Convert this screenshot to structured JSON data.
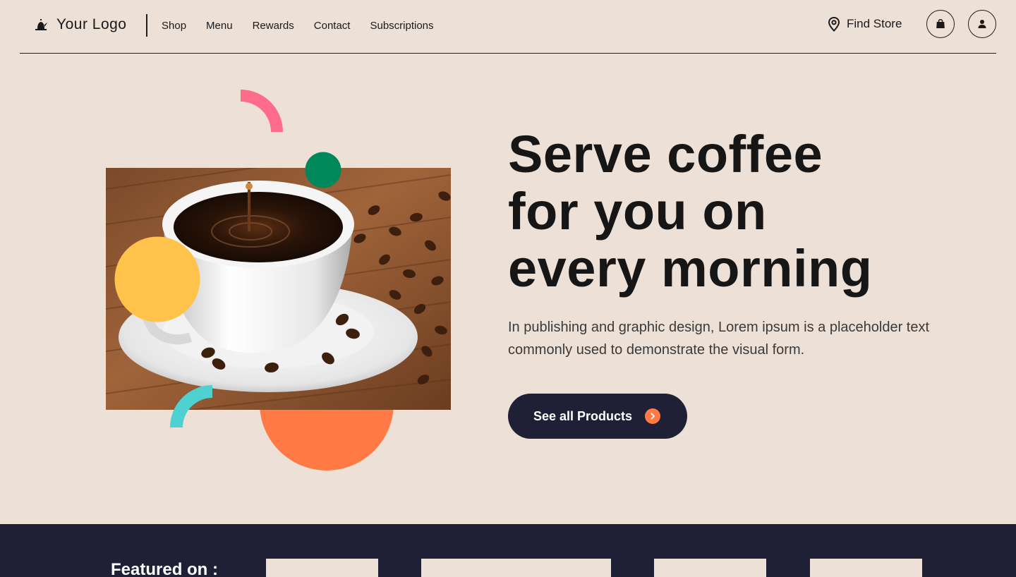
{
  "header": {
    "logo_text": "Your Logo",
    "nav": [
      "Shop",
      "Menu",
      "Rewards",
      "Contact",
      "Subscriptions"
    ],
    "find_store": "Find Store",
    "icons": {
      "logo": "coffee-kettle-icon",
      "find_store": "map-pin-icon",
      "cart": "shopping-bag-icon",
      "account": "user-icon"
    }
  },
  "hero": {
    "title_lines": [
      "Serve coffee",
      "for you on",
      "every morning"
    ],
    "description": "In publishing and graphic design, Lorem ipsum is a placeholder text commonly used to demonstrate the visual form.",
    "cta_label": "See all Products",
    "cta_icon": "chevron-right-icon",
    "image": "coffee-cup-with-beans-photo",
    "decor_colors": {
      "pink": "#FF6B8A",
      "green": "#00875A",
      "yellow": "#FFC24B",
      "teal": "#4FD1D1",
      "orange": "#FF7A45"
    }
  },
  "featured": {
    "label": "Featured on :"
  },
  "colors": {
    "background": "#EDE0D6",
    "dark": "#1F1F36",
    "text": "#161616",
    "accent": "#FF7A45"
  }
}
